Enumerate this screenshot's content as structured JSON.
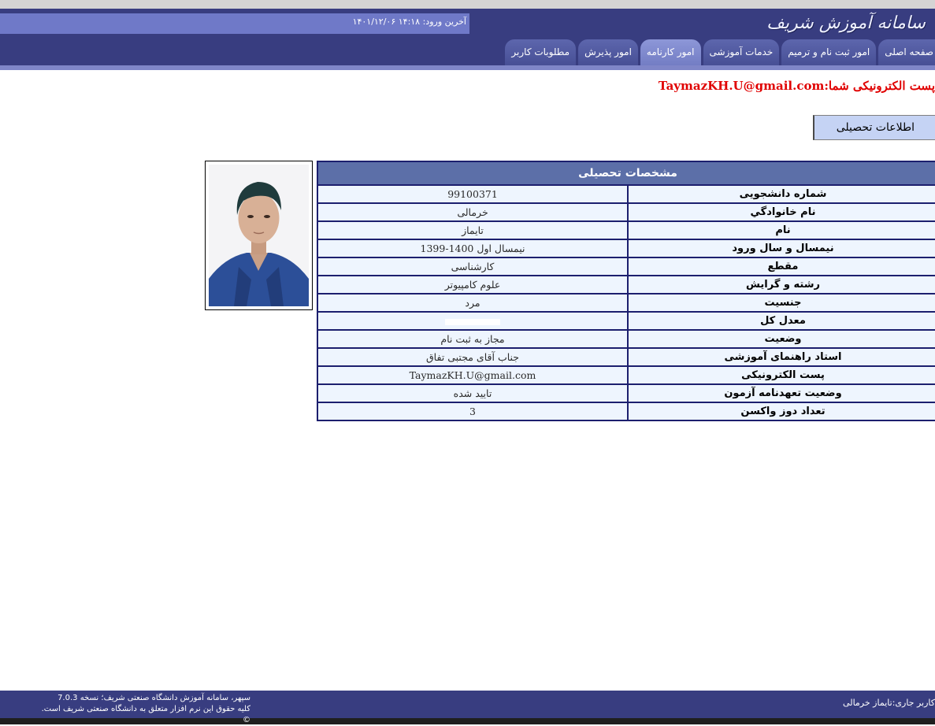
{
  "header": {
    "logo_text": "سامانه آموزش شریف",
    "last_login_label": "آخرین ورود:",
    "last_login_value": "۱۴:۱۸ ۱۴۰۱/۱۲/۰۶"
  },
  "tabs": [
    {
      "label": "صفحه اصلی",
      "active": false
    },
    {
      "label": "امور ثبت نام و ترمیم",
      "active": false
    },
    {
      "label": "خدمات آموزشی",
      "active": false
    },
    {
      "label": "امور کارنامه",
      "active": true
    },
    {
      "label": "امور پذیرش",
      "active": false
    },
    {
      "label": "مطلوبات کاربر",
      "active": false
    }
  ],
  "email_notice": {
    "label": "پست الکترونیکی شما:",
    "value": "TaymazKH.U@gmail.com"
  },
  "edu_info_button": "اطلاعات تحصیلی",
  "student_photo": "student-portrait",
  "table": {
    "title": "مشخصات تحصیلی",
    "rows": [
      {
        "label": "شماره دانشجویی",
        "value": "99100371"
      },
      {
        "label": "نام خانوادگي",
        "value": "خرمالی"
      },
      {
        "label": "نام",
        "value": "تایماز"
      },
      {
        "label": "نیمسال و سال ورود",
        "value": "نیمسال اول 1400-1399"
      },
      {
        "label": "مقطع",
        "value": "کارشناسی"
      },
      {
        "label": "رشته و گرايش",
        "value": "علوم کامپیوتر"
      },
      {
        "label": "جنسیت",
        "value": "مرد"
      },
      {
        "label": "معدل کل",
        "value": ""
      },
      {
        "label": "وضعیت",
        "value": "مجاز به ثبت نام"
      },
      {
        "label": "استاد راهنمای آموزشی",
        "value": "جناب آقای مجتبی تفاق"
      },
      {
        "label": "پست الکترونیکی",
        "value": "TaymazKH.U@gmail.com"
      },
      {
        "label": "وضعیت تعهدنامه آزمون",
        "value": "تایید شده"
      },
      {
        "label": "تعداد دوز واکسن",
        "value": "3"
      }
    ]
  },
  "footer": {
    "line1": "سپهر، سامانه آموزش دانشگاه صنعتی شریف؛ نسخه 7.0.3",
    "line2": "کلیه حقوق این نرم افزار متعلق به دانشگاه صنعتی شریف است. ©",
    "current_user_label": "کاربر جاری:",
    "current_user_value": "تایماز خرمالی"
  },
  "colors": {
    "header_bg": "#383d80",
    "tab_bg": "#4f589e",
    "tab_active_bg": "#7f89cf",
    "table_header_bg": "#5c6fa8",
    "table_cell_bg": "#eef5fe",
    "email_red": "#e00000"
  }
}
